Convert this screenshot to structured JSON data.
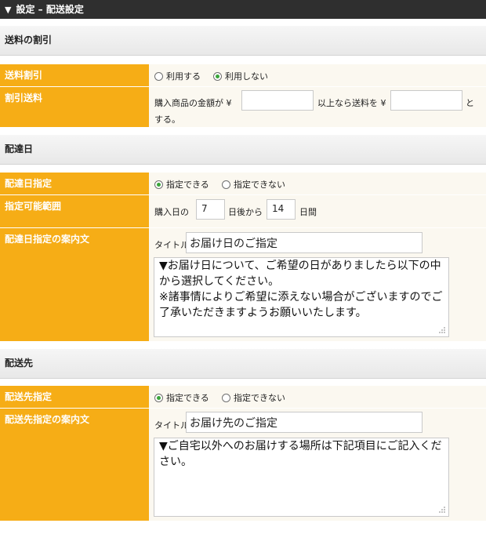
{
  "header": {
    "title": "設定 – 配送設定"
  },
  "sections": {
    "discount": {
      "title": "送料の割引"
    },
    "delivery_date": {
      "title": "配達日"
    },
    "destination": {
      "title": "配送先"
    }
  },
  "rows": {
    "shipping_discount": {
      "label": "送料割引",
      "options": [
        "利用する",
        "利用しない"
      ],
      "selected": "利用しない"
    },
    "discounted_shipping": {
      "label": "割引送料",
      "text_before": "購入商品の金額が ¥",
      "text_middle": "以上なら送料を ¥",
      "text_after_1": "と",
      "text_after_2": "する。",
      "amount_value": "",
      "shipping_value": ""
    },
    "delivery_date_spec": {
      "label": "配達日指定",
      "options": [
        "指定できる",
        "指定できない"
      ],
      "selected": "指定できる"
    },
    "date_range": {
      "label": "指定可能範囲",
      "prefix": "購入日の",
      "from_value": "7",
      "middle": "日後から",
      "to_value": "14",
      "suffix": "日間"
    },
    "delivery_date_guide": {
      "label": "配達日指定の案内文",
      "title_label": "タイトル",
      "title_value": "お届け日のご指定",
      "body": "▼お届け日について、ご希望の日がありましたら以下の中から選択してください。\n※諸事情によりご希望に添えない場合がございますのでご了承いただきますようお願いいたします。"
    },
    "destination_spec": {
      "label": "配送先指定",
      "options": [
        "指定できる",
        "指定できない"
      ],
      "selected": "指定できる"
    },
    "destination_guide": {
      "label": "配送先指定の案内文",
      "title_label": "タイトル",
      "title_value": "お届け先のご指定",
      "body": "▼ご自宅以外へのお届けする場所は下記項目にご記入ください。"
    }
  },
  "colors": {
    "label_bg": "#f6ad16",
    "topbar_bg": "#2f2f2f",
    "value_bg": "#fbf8f0",
    "radio_checked": "#3aa53a"
  }
}
